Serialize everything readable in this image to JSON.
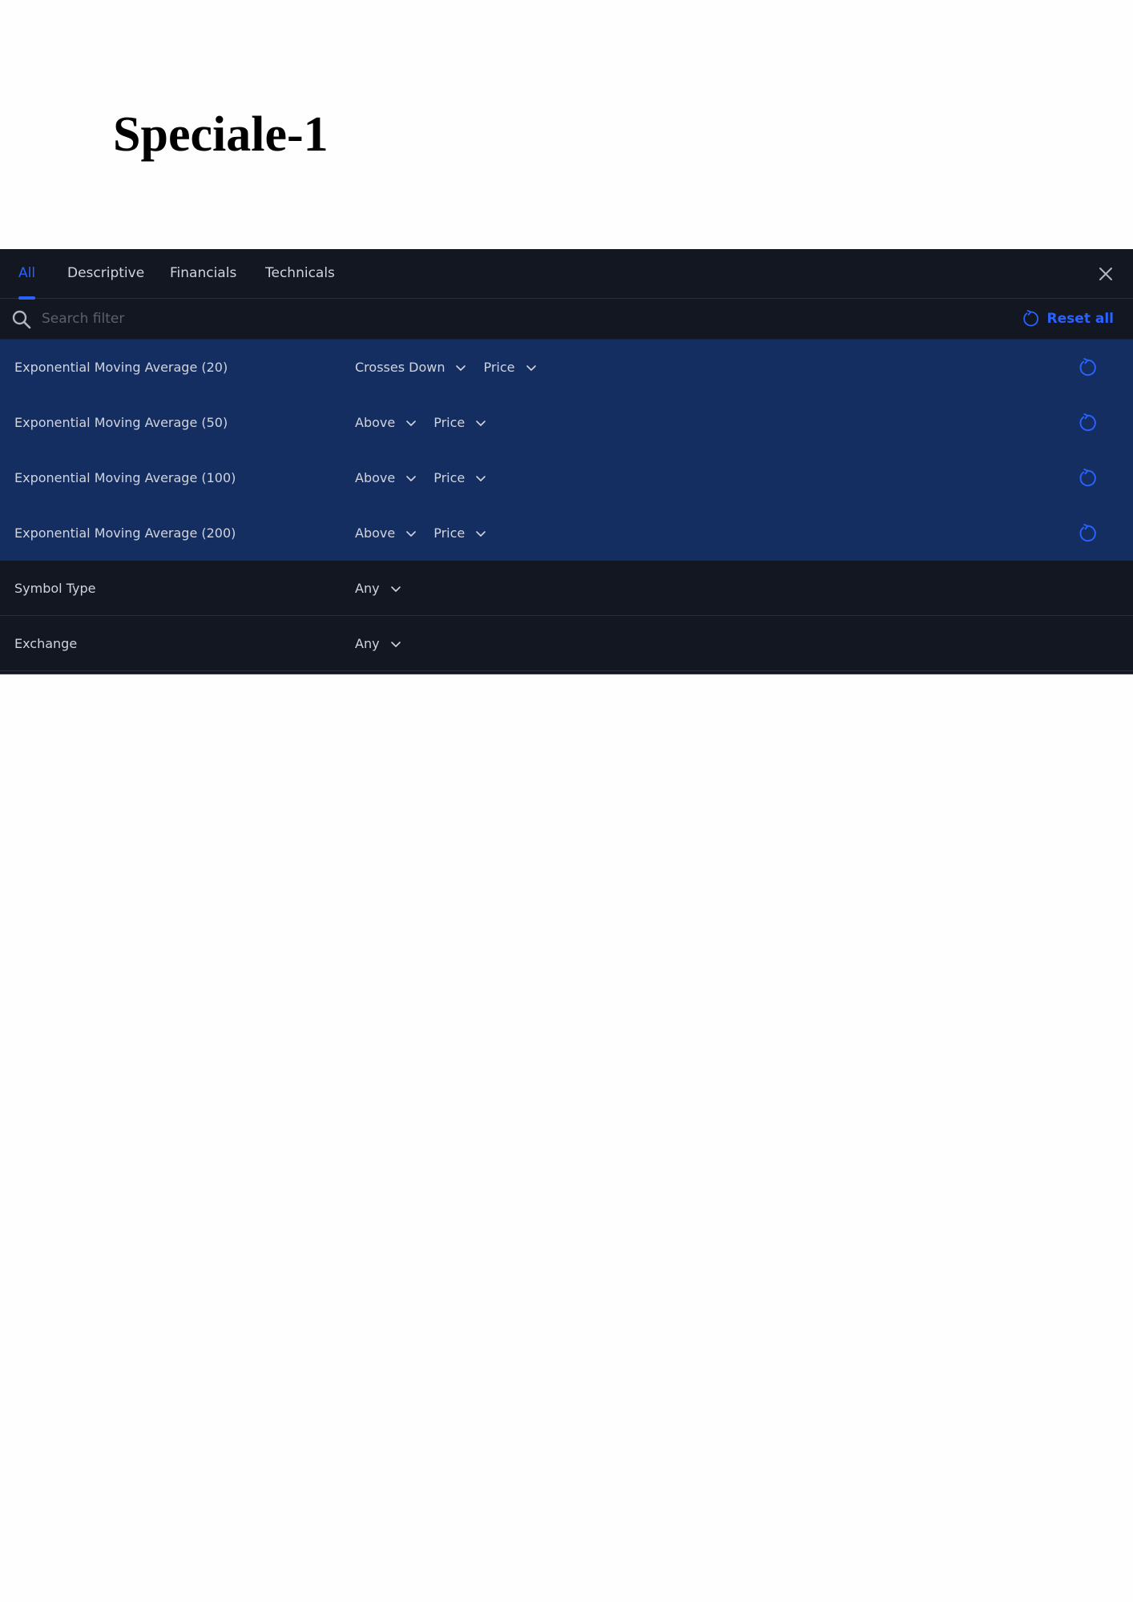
{
  "page": {
    "heading": "Speciale-1"
  },
  "colors": {
    "accent": "#2962ff",
    "panel_bg": "#131722",
    "active_row_bg": "#142e61",
    "text": "#d1d4dc"
  },
  "tabs": [
    {
      "label": "All",
      "active": true
    },
    {
      "label": "Descriptive",
      "active": false
    },
    {
      "label": "Financials",
      "active": false
    },
    {
      "label": "Technicals",
      "active": false
    }
  ],
  "search": {
    "value": "",
    "placeholder": "Search filter"
  },
  "reset_all_label": "Reset all",
  "filters": [
    {
      "label": "Exponential Moving Average (20)",
      "condition": "Crosses Down",
      "target": "Price",
      "active": true
    },
    {
      "label": "Exponential Moving Average (50)",
      "condition": "Above",
      "target": "Price",
      "active": true
    },
    {
      "label": "Exponential Moving Average (100)",
      "condition": "Above",
      "target": "Price",
      "active": true
    },
    {
      "label": "Exponential Moving Average (200)",
      "condition": "Above",
      "target": "Price",
      "active": true
    },
    {
      "label": "Symbol Type",
      "condition": "Any",
      "active": false
    },
    {
      "label": "Exchange",
      "condition": "Any",
      "active": false
    }
  ],
  "icons": {
    "close": "close-icon",
    "search": "search-icon",
    "reset": "reset-icon",
    "dropdown": "chevron-down-icon"
  }
}
